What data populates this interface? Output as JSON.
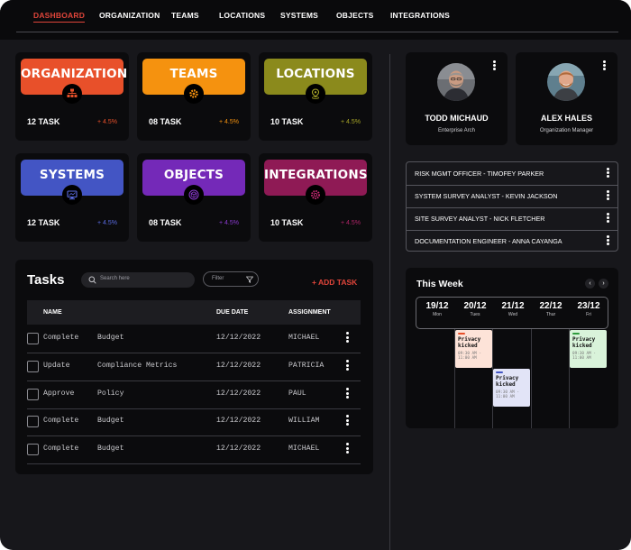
{
  "nav": {
    "items": [
      "DASHBOARD",
      "ORGANIZATION",
      "TEAMS",
      "LOCATIONS",
      "SYSTEMS",
      "OBJECTS",
      "INTEGRATIONS"
    ],
    "active": "DASHBOARD"
  },
  "cards": [
    {
      "title": "ORGANIZATION",
      "icon": "org-chart-icon",
      "tasks": "12 TASK",
      "change": "+ 4.5%",
      "color": "#e8502a",
      "pct_color": "#e8502a"
    },
    {
      "title": "TEAMS",
      "icon": "gear-icon",
      "tasks": "08 TASK",
      "change": "+ 4.5%",
      "color": "#f5920f",
      "pct_color": "#f5920f"
    },
    {
      "title": "LOCATIONS",
      "icon": "location-pin-icon",
      "tasks": "10 TASK",
      "change": "+ 4.5%",
      "color": "#8b8a1c",
      "pct_color": "#a8a628"
    },
    {
      "title": "SYSTEMS",
      "icon": "monitor-icon",
      "tasks": "12 TASK",
      "change": "+ 4.5%",
      "color": "#4355c4",
      "pct_color": "#5a6be0"
    },
    {
      "title": "OBJECTS",
      "icon": "cube-icon",
      "tasks": "08 TASK",
      "change": "+ 4.5%",
      "color": "#7429b8",
      "pct_color": "#8b3ad0"
    },
    {
      "title": "INTEGRATIONS",
      "icon": "integration-gear-icon",
      "tasks": "10 TASK",
      "change": "+ 4.5%",
      "color": "#8f1a55",
      "pct_color": "#b02468"
    }
  ],
  "tasks": {
    "title": "Tasks",
    "search_placeholder": "Search here",
    "filter_label": "Filter",
    "add_label": "+ ADD TASK",
    "columns": {
      "name": "NAME",
      "due": "DUE DATE",
      "assignment": "ASSIGNMENT"
    },
    "rows": [
      {
        "action": "Complete",
        "item": "Budget",
        "due": "12/12/2022",
        "assignee": "MICHAEL"
      },
      {
        "action": "Update",
        "item": "Compliance Metrics",
        "due": "12/12/2022",
        "assignee": "PATRICIA"
      },
      {
        "action": "Approve",
        "item": "Policy",
        "due": "12/12/2022",
        "assignee": "PAUL"
      },
      {
        "action": "Complete",
        "item": "Budget",
        "due": "12/12/2022",
        "assignee": "WILLIAM"
      },
      {
        "action": "Complete",
        "item": "Budget",
        "due": "12/12/2022",
        "assignee": "MICHAEL"
      }
    ]
  },
  "profiles": [
    {
      "name": "TODD MICHAUD",
      "role": "Enterprise Arch"
    },
    {
      "name": "ALEX HALES",
      "role": "Organization Manager"
    }
  ],
  "assignments": [
    "RISK MGMT OFFICER - TIMOFEY PARKER",
    "SYSTEM SURVEY ANALYST - KEVIN JACKSON",
    "SITE SURVEY ANALYST - NICK FLETCHER",
    "DOCUMENTATION ENGINEER - ANNA CAYANGA"
  ],
  "week": {
    "title": "This Week",
    "prev": "‹",
    "next": "›",
    "days": [
      {
        "date": "19/12",
        "name": "Mon"
      },
      {
        "date": "20/12",
        "name": "Tues"
      },
      {
        "date": "21/12",
        "name": "Wed"
      },
      {
        "date": "22/12",
        "name": "Thur"
      },
      {
        "date": "23/12",
        "name": "Fri"
      }
    ],
    "events": [
      {
        "title": "Privacy kicked",
        "time": "09:30 AM - 11:00 AM",
        "bg": "#fde3d8",
        "accent": "#e8502a"
      },
      {
        "title": "Privacy kicked",
        "time": "09:30 AM - 11:00 AM",
        "bg": "#e2e4f7",
        "accent": "#4355c4"
      },
      {
        "title": "Privacy kicked",
        "time": "09:30 AM - 11:00 AM",
        "bg": "#d9f3da",
        "accent": "#2f9b3d"
      }
    ]
  }
}
